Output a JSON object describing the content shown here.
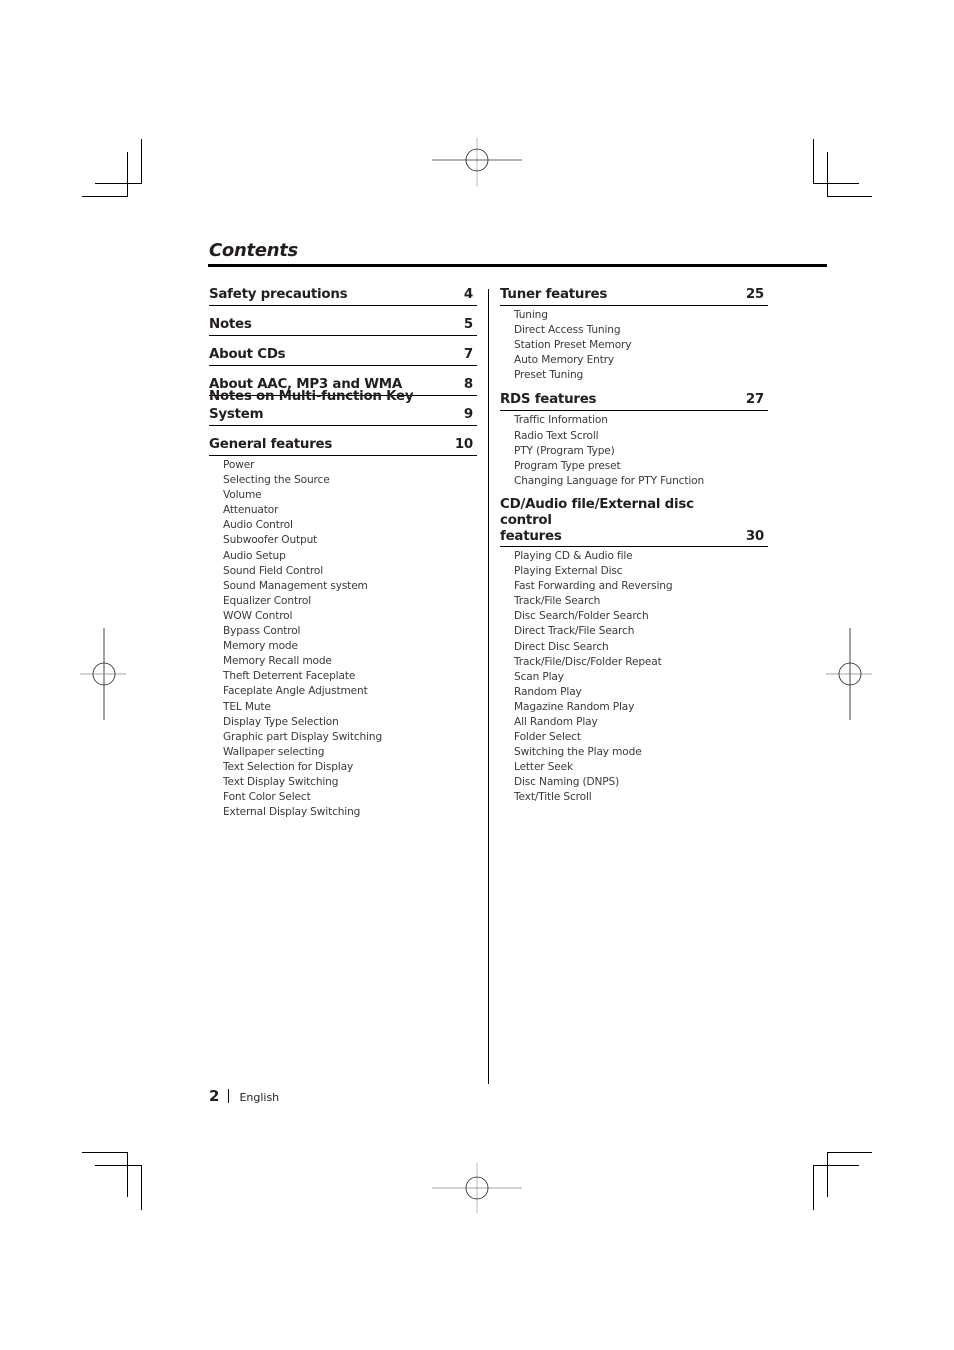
{
  "page": {
    "title": "Contents",
    "footer": {
      "page_number": "2",
      "language": "English"
    }
  },
  "left_column": {
    "sections": [
      {
        "title": "Safety precautions",
        "page": "4",
        "items": []
      },
      {
        "title": "Notes",
        "page": "5",
        "items": []
      },
      {
        "title": "About CDs",
        "page": "7",
        "items": []
      },
      {
        "title": "About AAC, MP3 and WMA",
        "page": "8",
        "items": []
      },
      {
        "title": "Notes on Multi-function Key System",
        "page": "9",
        "items": []
      },
      {
        "title": "General features",
        "page": "10",
        "items": [
          "Power",
          "Selecting the Source",
          "Volume",
          "Attenuator",
          "Audio Control",
          "Subwoofer Output",
          "Audio Setup",
          "Sound Field Control",
          "Sound Management system",
          "Equalizer Control",
          "WOW Control",
          "Bypass Control",
          "Memory mode",
          "Memory Recall mode",
          "Theft Deterrent Faceplate",
          "Faceplate Angle Adjustment",
          "TEL Mute",
          "Display Type Selection",
          "Graphic part Display Switching",
          "Wallpaper selecting",
          "Text Selection for Display",
          "Text Display Switching",
          "Font Color Select",
          "External Display Switching"
        ]
      }
    ]
  },
  "right_column": {
    "sections": [
      {
        "title": "Tuner features",
        "page": "25",
        "items": [
          "Tuning",
          "Direct Access Tuning",
          "Station Preset Memory",
          "Auto Memory Entry",
          "Preset Tuning"
        ]
      },
      {
        "title": "RDS features",
        "page": "27",
        "items": [
          "Traffic Information",
          "Radio Text Scroll",
          "PTY (Program Type)",
          "Program Type preset",
          "Changing Language for PTY Function"
        ]
      },
      {
        "title": "CD/Audio file/External disc control\nfeatures",
        "page": "30",
        "items": [
          "Playing CD & Audio file",
          "Playing External Disc",
          "Fast Forwarding and Reversing",
          "Track/File Search",
          "Disc Search/Folder Search",
          "Direct Track/File Search",
          "Direct Disc Search",
          "Track/File/Disc/Folder Repeat",
          "Scan Play",
          "Random Play",
          "Magazine Random Play",
          "All Random Play",
          "Folder Select",
          "Switching the Play mode",
          "Letter Seek",
          "Disc Naming (DNPS)",
          "Text/Title Scroll"
        ]
      }
    ]
  }
}
